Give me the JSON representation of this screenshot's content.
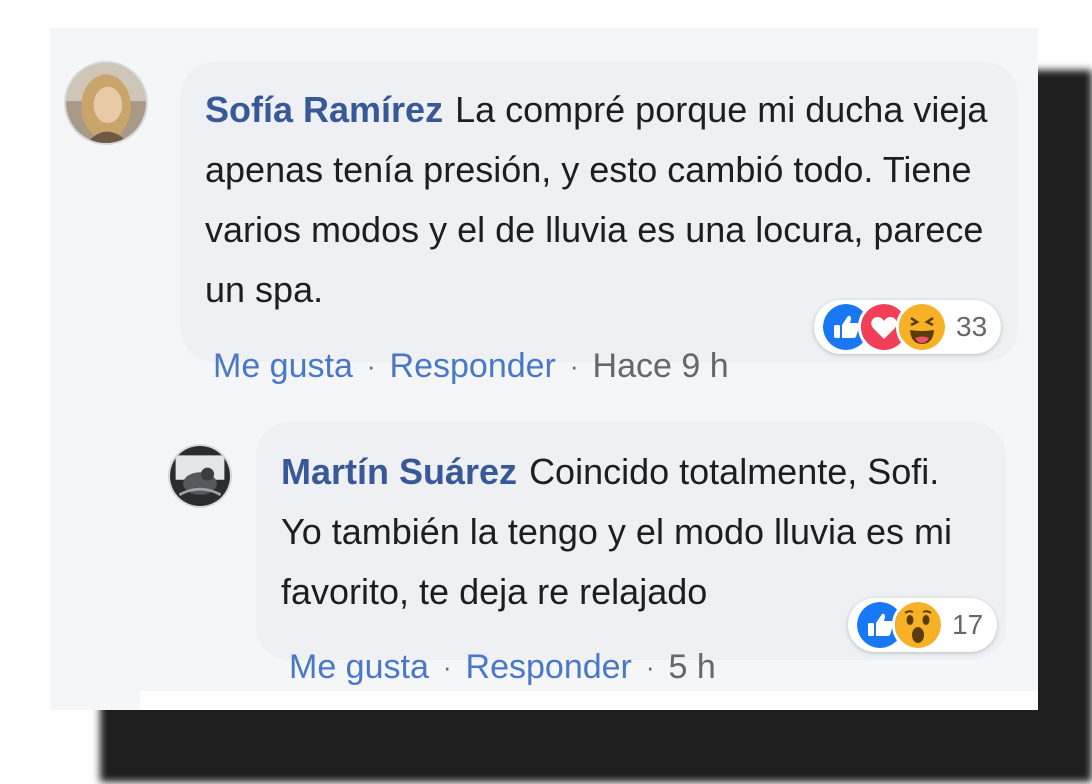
{
  "comments": [
    {
      "author": "Sofía Ramírez",
      "text": "La compré porque mi ducha vieja apenas tenía presión, y esto cambió todo. Tiene varios modos y el de lluvia es una locura, parece un spa.",
      "reactions": [
        "like-icon",
        "love-icon",
        "haha-icon"
      ],
      "reaction_count": "33",
      "like_label": "Me gusta",
      "reply_label": "Responder",
      "separator": "·",
      "timestamp": "Hace 9 h"
    },
    {
      "author": "Martín Suárez",
      "text": "Coincido totalmente, Sofi. Yo también la tengo y el modo lluvia es mi favorito, te deja re relajado",
      "reactions": [
        "like-icon",
        "wow-icon"
      ],
      "reaction_count": "17",
      "like_label": "Me gusta",
      "reply_label": "Responder",
      "separator": "·",
      "timestamp": "5 h"
    }
  ],
  "colors": {
    "author": "#385898",
    "link": "#4a78c9",
    "like": "#1877f2",
    "love": "#f33e58",
    "haha": "#f7b125",
    "bubble": "#eef0f3"
  }
}
